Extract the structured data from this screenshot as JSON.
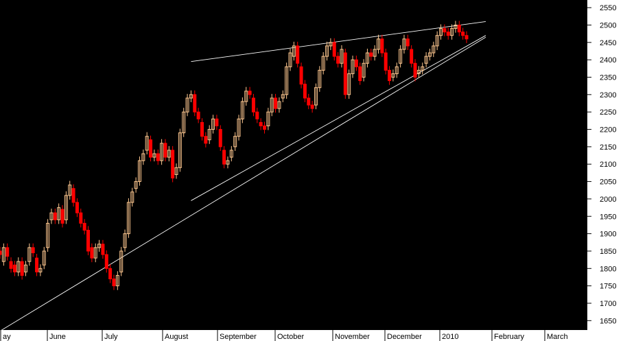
{
  "chart_data": {
    "type": "candlestick",
    "title": "",
    "xlabel": "",
    "ylabel": "",
    "ylim": [
      1623,
      2572
    ],
    "y_ticks": [
      1650,
      1700,
      1750,
      1800,
      1850,
      1900,
      1950,
      2000,
      2050,
      2100,
      2150,
      2200,
      2250,
      2300,
      2350,
      2400,
      2450,
      2500,
      2550
    ],
    "x_labels": [
      "ay",
      "June",
      "July",
      "August",
      "September",
      "October",
      "November",
      "December",
      "2010",
      "February",
      "March"
    ],
    "grid": false,
    "colors": {
      "background": "#000000",
      "axis_panel": "#ffffff",
      "up_candle": "#ffc890",
      "down_candle": "#ff0000",
      "trendline": "#ffffff"
    },
    "candles_note_series": "daily OHLC",
    "series": [
      {
        "name": "",
        "close": [
          1840,
          1860,
          1835,
          1800,
          1790,
          1820,
          1780,
          1810,
          1860,
          1845,
          1790,
          1800,
          1850,
          1930,
          1960,
          1940,
          1975,
          1930,
          2010,
          2040,
          1990,
          1960,
          1930,
          1910,
          1850,
          1830,
          1860,
          1870,
          1840,
          1800,
          1770,
          1750,
          1780,
          1850,
          1900,
          1990,
          2020,
          2050,
          2110,
          2130,
          2180,
          2120,
          2130,
          2110,
          2160,
          2120,
          2140,
          2060,
          2090,
          2190,
          2250,
          2290,
          2300,
          2250,
          2230,
          2180,
          2160,
          2200,
          2230,
          2210,
          2150,
          2100,
          2110,
          2140,
          2180,
          2230,
          2280,
          2310,
          2300,
          2250,
          2230,
          2210,
          2200,
          2250,
          2290,
          2260,
          2280,
          2300,
          2380,
          2420,
          2440,
          2390,
          2330,
          2290,
          2270,
          2260,
          2320,
          2370,
          2410,
          2440,
          2450,
          2410,
          2390,
          2430,
          2300,
          2360,
          2400,
          2380,
          2340,
          2390,
          2420,
          2410,
          2430,
          2460,
          2420,
          2370,
          2340,
          2360,
          2380,
          2430,
          2460,
          2440,
          2390,
          2350,
          2370,
          2380,
          2410,
          2420,
          2440,
          2470,
          2490,
          2480,
          2470,
          2490,
          2500,
          2480,
          2470,
          2460
        ],
        "open": [
          1850,
          1820,
          1860,
          1820,
          1810,
          1790,
          1820,
          1790,
          1820,
          1860,
          1830,
          1790,
          1810,
          1860,
          1940,
          1960,
          1940,
          1970,
          1940,
          2010,
          2030,
          1990,
          1960,
          1930,
          1910,
          1860,
          1830,
          1860,
          1870,
          1840,
          1800,
          1770,
          1750,
          1790,
          1860,
          1900,
          1990,
          2030,
          2050,
          2110,
          2140,
          2170,
          2120,
          2130,
          2110,
          2160,
          2120,
          2140,
          2070,
          2090,
          2190,
          2250,
          2290,
          2300,
          2250,
          2220,
          2180,
          2170,
          2200,
          2230,
          2200,
          2140,
          2100,
          2120,
          2150,
          2180,
          2230,
          2280,
          2310,
          2290,
          2250,
          2220,
          2210,
          2210,
          2250,
          2290,
          2260,
          2290,
          2300,
          2380,
          2410,
          2440,
          2380,
          2330,
          2290,
          2270,
          2270,
          2320,
          2370,
          2410,
          2440,
          2450,
          2410,
          2390,
          2420,
          2300,
          2360,
          2400,
          2380,
          2350,
          2390,
          2420,
          2410,
          2430,
          2460,
          2420,
          2370,
          2350,
          2360,
          2390,
          2430,
          2460,
          2430,
          2390,
          2360,
          2370,
          2390,
          2410,
          2420,
          2440,
          2470,
          2490,
          2480,
          2470,
          2490,
          2500,
          2480,
          2470
        ]
      }
    ],
    "trendlines": [
      {
        "from": [
          0,
          1620
        ],
        "to": [
          124,
          2465
        ]
      },
      {
        "from": [
          52,
          1995
        ],
        "to": [
          124,
          2470
        ]
      },
      {
        "from": [
          52,
          2395
        ],
        "to": [
          124,
          2510
        ]
      }
    ]
  }
}
